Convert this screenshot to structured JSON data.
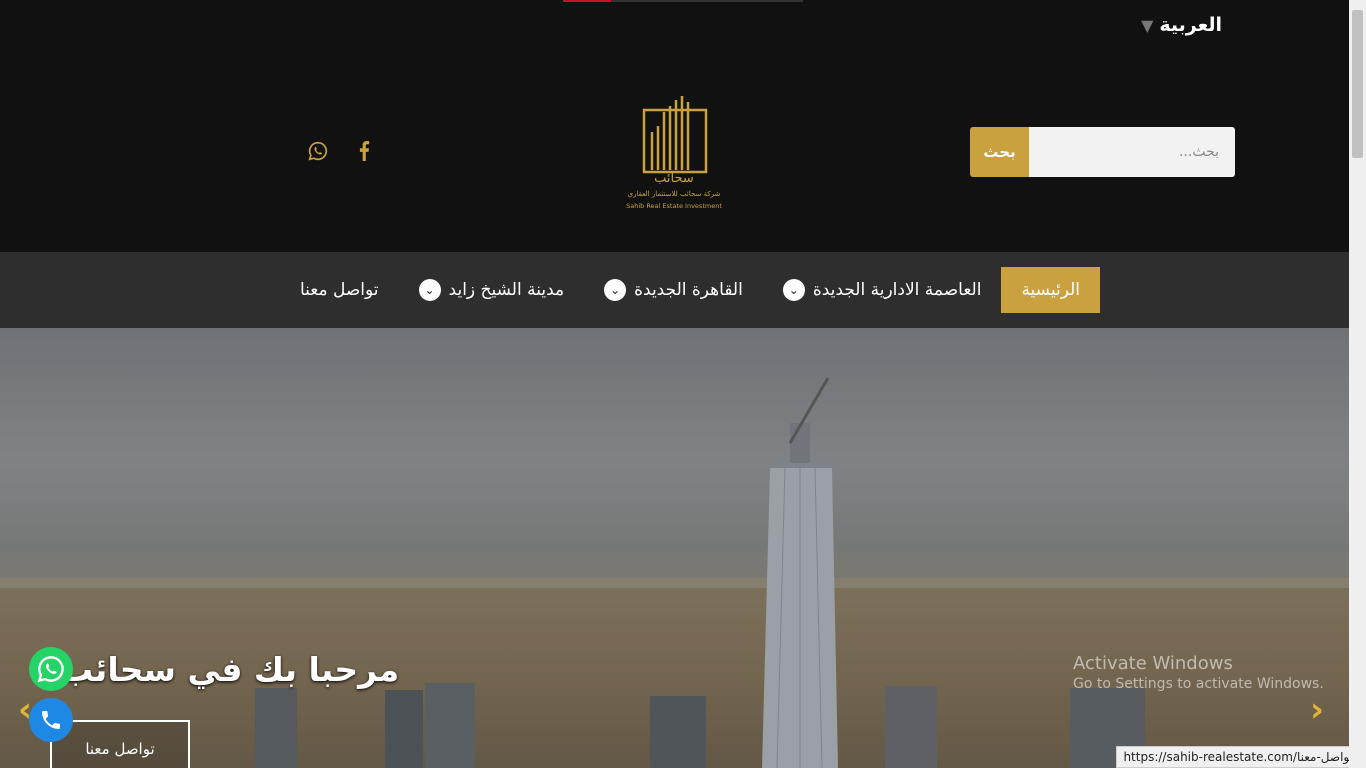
{
  "progress_bar": {
    "fraction": 0.2
  },
  "language": {
    "label": "العربية",
    "arrow_icon": "triangle-down-icon"
  },
  "search": {
    "button_label": "بحث",
    "placeholder": "بحث..."
  },
  "social": [
    {
      "icon": "whatsapp-icon"
    },
    {
      "icon": "facebook-icon"
    }
  ],
  "logo": {
    "arabic_word": "سحائب",
    "tagline_ar": "شركة سحائب للاستثمار العقاري",
    "tagline_en": "Sahib Real Estate Investment"
  },
  "nav": {
    "items": [
      {
        "label": "الرئيسية",
        "active": true,
        "has_dropdown": false
      },
      {
        "label": "العاصمة الادارية الجديدة",
        "active": false,
        "has_dropdown": true
      },
      {
        "label": "القاهرة الجديدة",
        "active": false,
        "has_dropdown": true
      },
      {
        "label": "مدينة الشيخ زايد",
        "active": false,
        "has_dropdown": true
      },
      {
        "label": "تواصل معنا",
        "active": false,
        "has_dropdown": false
      }
    ]
  },
  "hero": {
    "title": "مرحبا بك في سحائب",
    "cta_label": "تواصل معنا"
  },
  "floating": {
    "whatsapp_icon": "whatsapp-icon",
    "phone_icon": "phone-icon"
  },
  "watermark": {
    "line1": "Activate Windows",
    "line2": "Go to Settings to activate Windows."
  },
  "status_url": "https://sahib-realestate.com/تواصل-معنا/",
  "colors": {
    "accent": "#c9a13f",
    "topbar": "#111111",
    "nav": "#2e2e2e"
  }
}
